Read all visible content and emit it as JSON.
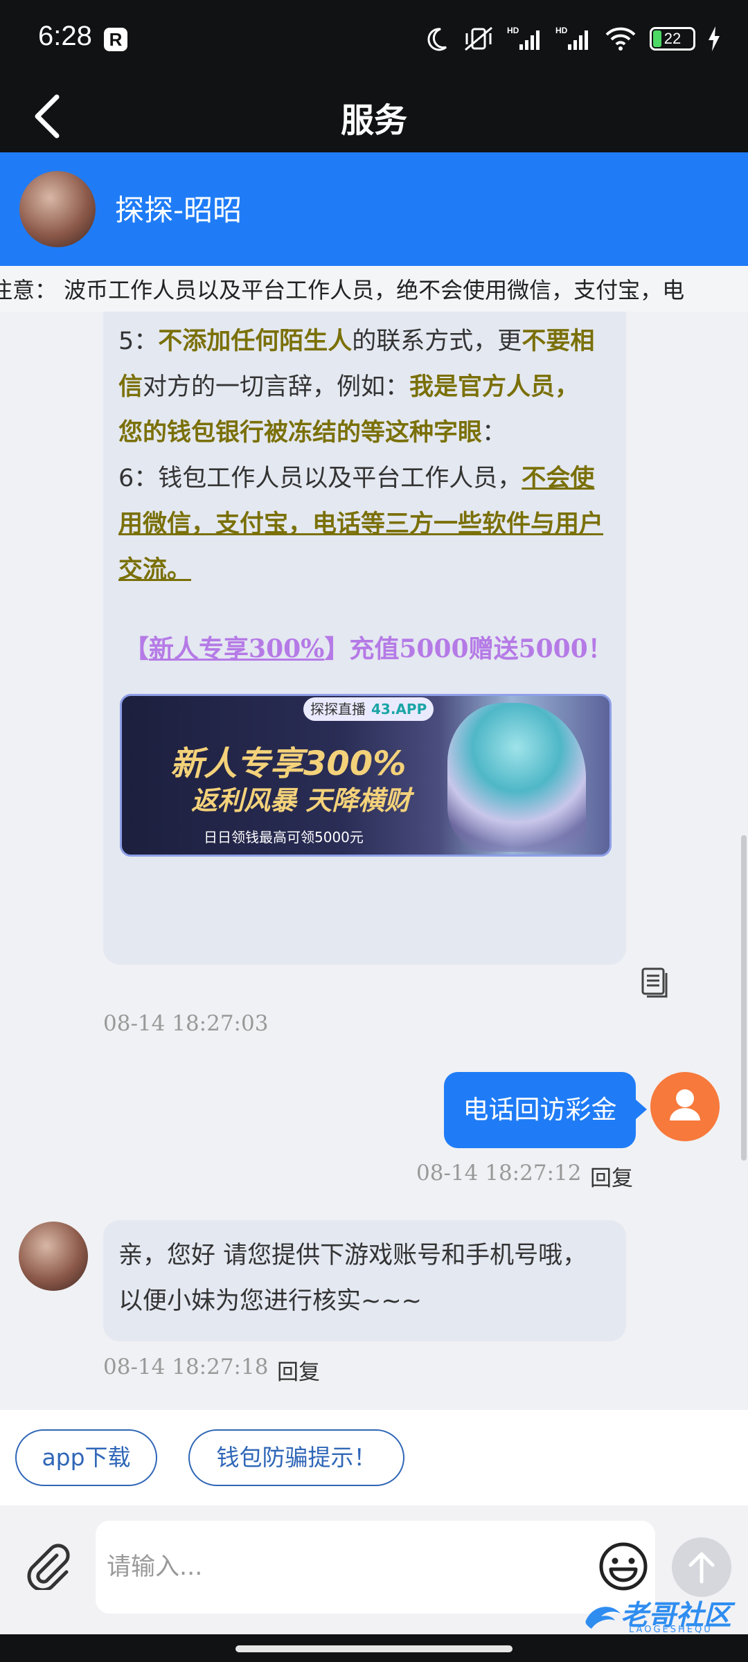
{
  "status_bar": {
    "time": "6:28",
    "app_badge": "R",
    "battery": "22",
    "battery_level": 0.22,
    "icons": [
      "moon-icon",
      "vibrate-off-icon",
      "hd-signal-icon",
      "hd-signal-icon",
      "wifi-icon",
      "battery-icon",
      "charging-icon"
    ]
  },
  "header": {
    "title": "服务",
    "back_icon": "chevron-left-icon"
  },
  "agent": {
    "name": "探探-昭昭"
  },
  "notice": {
    "text": "注意： 波币工作人员以及平台工作人员，绝不会使用微信，支付宝，电"
  },
  "messages": [
    {
      "side": "left",
      "rich": {
        "l1_a": "5：",
        "l1_b": "不添加任何陌生人",
        "l1_c": "的联系方式，更",
        "l1_d": "不要相信",
        "l1_e": "对方的一切言辞，例如：",
        "l1_f": "我是官方人员，您的钱包银行被冻结的等这种字眼",
        "l1_g": "：",
        "l2_a": "6：钱包工作人员以及平台工作人员，",
        "l2_b": "不会使用微信，支付宝，电话等三方一些软件与用户交流。",
        "promo_open": "【",
        "promo_link": "新人专享300%",
        "promo_close": "】充值5000赠送5000！"
      },
      "banner": {
        "chip_label": "探探直播",
        "chip_domain": "43.APP",
        "headline": "新人专享300%",
        "subline": "返利风暴 天降横财",
        "footnote": "日日领钱最高可领5000元"
      },
      "timestamp": "08-14 18:27:03"
    },
    {
      "side": "right",
      "text": "电话回访彩金",
      "timestamp": "08-14 18:27:12",
      "reply_label": "回复"
    },
    {
      "side": "left",
      "text": "亲，您好 请您提供下游戏账号和手机号哦，以便小妹为您进行核实~~~",
      "timestamp": "08-14 18:27:18",
      "reply_label": "回复"
    }
  ],
  "quick_actions": [
    "app下载",
    "钱包防骗提示！"
  ],
  "composer": {
    "placeholder": "请输入..."
  },
  "watermark": {
    "title": "老哥社区",
    "sub": "LAOGESHEQU"
  },
  "colors": {
    "primary_blue": "#1f7cf6",
    "header_dark": "#111214",
    "user_avatar": "#f7793c",
    "olive_highlight": "#7a7008",
    "promo_purple": "#b57ae6"
  }
}
